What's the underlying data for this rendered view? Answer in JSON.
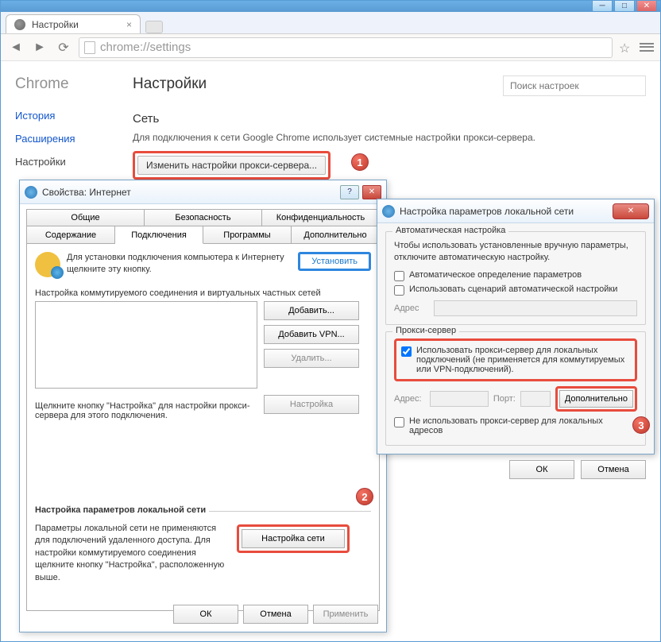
{
  "tab": {
    "title": "Настройки"
  },
  "omnibox": {
    "url": "chrome://settings"
  },
  "brand": "Chrome",
  "sidebar": {
    "items": [
      {
        "label": "История"
      },
      {
        "label": "Расширения"
      },
      {
        "label": "Настройки"
      }
    ]
  },
  "content": {
    "heading": "Настройки",
    "search_placeholder": "Поиск настроек",
    "network_title": "Сеть",
    "network_desc": "Для подключения к сети Google Chrome использует системные настройки прокси-сервера.",
    "proxy_button": "Изменить настройки прокси-сервера..."
  },
  "callouts": {
    "one": "1",
    "two": "2",
    "three": "3"
  },
  "ip": {
    "title": "Свойства: Интернет",
    "tabs_row1": [
      "Общие",
      "Безопасность",
      "Конфиденциальность"
    ],
    "tabs_row2": [
      "Содержание",
      "Подключения",
      "Программы",
      "Дополнительно"
    ],
    "selected_tab": "Подключения",
    "setup_text": "Для установки подключения компьютера к Интернету щелкните эту кнопку.",
    "setup_btn": "Установить",
    "dial_label": "Настройка коммутируемого соединения и виртуальных частных сетей",
    "btn_add": "Добавить...",
    "btn_add_vpn": "Добавить VPN...",
    "btn_delete": "Удалить...",
    "btn_settings": "Настройка",
    "proxy_hint": "Щелкните кнопку \"Настройка\" для настройки прокси-сервера для этого подключения.",
    "lan_label": "Настройка параметров локальной сети",
    "lan_text": "Параметры локальной сети не применяются для подключений удаленного доступа. Для настройки коммутируемого соединения щелкните кнопку \"Настройка\", расположенную выше.",
    "lan_btn": "Настройка сети",
    "ok": "ОК",
    "cancel": "Отмена",
    "apply": "Применить"
  },
  "lan": {
    "title": "Настройка параметров локальной сети",
    "auto_legend": "Автоматическая настройка",
    "auto_desc": "Чтобы использовать установленные вручную параметры, отключите автоматическую настройку.",
    "auto_detect": "Автоматическое определение параметров",
    "use_script": "Использовать сценарий автоматической настройки",
    "addr_label": "Адрес",
    "proxy_legend": "Прокси-сервер",
    "use_proxy": "Использовать прокси-сервер для локальных подключений (не применяется для коммутируемых или VPN-подключений).",
    "addr2": "Адрес:",
    "port": "Порт:",
    "advanced": "Дополнительно",
    "bypass_local": "Не использовать прокси-сервер для локальных адресов",
    "ok": "ОК",
    "cancel": "Отмена"
  }
}
